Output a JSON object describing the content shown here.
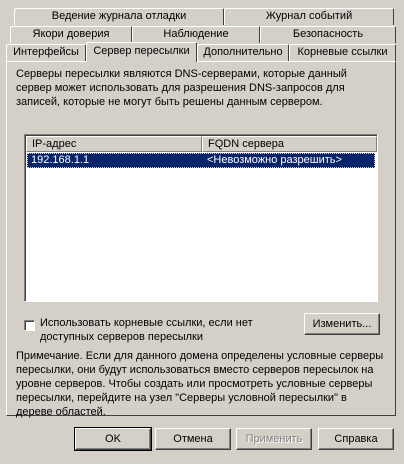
{
  "tabs_row1": [
    {
      "label": "Ведение журнала отладки"
    },
    {
      "label": "Журнал событий"
    }
  ],
  "tabs_row2": [
    {
      "label": "Якори доверия"
    },
    {
      "label": "Наблюдение"
    },
    {
      "label": "Безопасность"
    }
  ],
  "tabs_row3": [
    {
      "label": "Интерфейсы"
    },
    {
      "label": "Сервер пересылки",
      "selected": true
    },
    {
      "label": "Дополнительно"
    },
    {
      "label": "Корневые ссылки"
    }
  ],
  "description": "Серверы пересылки являются DNS-серверами, которые данный сервер может использовать для разрешения DNS-запросов для записей, которые не могут быть решены данным сервером.",
  "forwarders_list": {
    "columns": [
      "IP-адрес",
      "FQDN сервера"
    ],
    "rows": [
      {
        "ip": "192.168.1.1",
        "fqdn": "<Невозможно разрешить>",
        "selected": true
      }
    ]
  },
  "use_root_hints": {
    "label": "Использовать корневые ссылки, если нет доступных серверов пересылки",
    "checked": false
  },
  "edit_button": "Изменить...",
  "note": "Примечание. Если для данного домена определены условные серверы пересылки, они будут использоваться вместо серверов пересылок на уровне серверов. Чтобы создать или просмотреть условные серверы пересылки, перейдите на узел \"Серверы условной пересылки\" в дереве областей.",
  "dialog_buttons": {
    "ok": "OK",
    "cancel": "Отмена",
    "apply": "Применить",
    "help": "Справка"
  },
  "colors": {
    "selection": "#0a246a",
    "face": "#d4d0c8"
  }
}
